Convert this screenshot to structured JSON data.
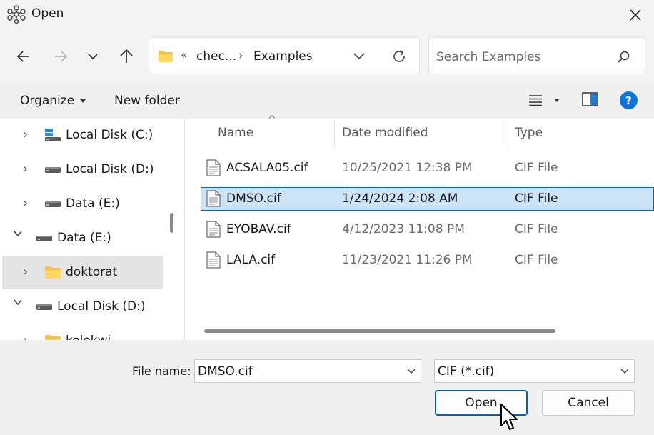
{
  "window": {
    "title": "Open",
    "app_icon": "molecule-icon",
    "close_icon": "close-icon"
  },
  "nav": {
    "back_icon": "arrow-left-icon",
    "forward_icon": "arrow-right-icon",
    "recent_icon": "chevron-down-icon",
    "up_icon": "arrow-up-icon"
  },
  "address": {
    "overflow": "«",
    "crumbs": [
      "chec...",
      "Examples"
    ],
    "separator": "›",
    "refresh_icon": "refresh-icon"
  },
  "search": {
    "placeholder": "Search Examples",
    "icon": "search-icon"
  },
  "toolbar": {
    "organize_label": "Organize",
    "new_folder_label": "New folder",
    "help_label": "?",
    "colors": {
      "help": "#0a74d9",
      "preview_pane": "#1a7fd4"
    }
  },
  "sidebar": {
    "items": [
      {
        "label": "Local Disk (C:)",
        "icon": "windows-drive-icon",
        "expander": "›",
        "selected": false
      },
      {
        "label": "Local Disk (D:)",
        "icon": "drive-icon",
        "expander": "›",
        "selected": false
      },
      {
        "label": "Data (E:)",
        "icon": "drive-icon",
        "expander": "›",
        "selected": false
      },
      {
        "label": "Data (E:)",
        "icon": "drive-icon",
        "expander": "⌄",
        "selected": false
      },
      {
        "label": "doktorat",
        "icon": "folder-icon",
        "expander": "›",
        "selected": true
      },
      {
        "label": "Local Disk (D:)",
        "icon": "drive-icon",
        "expander": "⌄",
        "selected": false
      },
      {
        "label": "kolokwi",
        "icon": "folder-icon",
        "expander": "›",
        "selected": false
      }
    ]
  },
  "filelist": {
    "columns": {
      "name": "Name",
      "date": "Date modified",
      "type": "Type"
    },
    "sort_indicator": "^",
    "rows": [
      {
        "name": "ACSALA05.cif",
        "date": "10/25/2021 12:38 PM",
        "type": "CIF File",
        "selected": false
      },
      {
        "name": "DMSO.cif",
        "date": "1/24/2024 2:08 AM",
        "type": "CIF File",
        "selected": true
      },
      {
        "name": "EYOBAV.cif",
        "date": "4/12/2023 11:08 PM",
        "type": "CIF File",
        "selected": false
      },
      {
        "name": "LALA.cif",
        "date": "11/23/2021 11:26 PM",
        "type": "CIF File",
        "selected": false
      }
    ],
    "colors": {
      "selection_bg": "#cce4f7",
      "selection_border": "#0a5fae"
    }
  },
  "footer": {
    "filename_label": "File name:",
    "filename_value": "DMSO.cif",
    "filetype_value": "CIF (*.cif)",
    "open_label": "Open",
    "cancel_label": "Cancel",
    "colors": {
      "open_border": "#0a5fae"
    }
  }
}
